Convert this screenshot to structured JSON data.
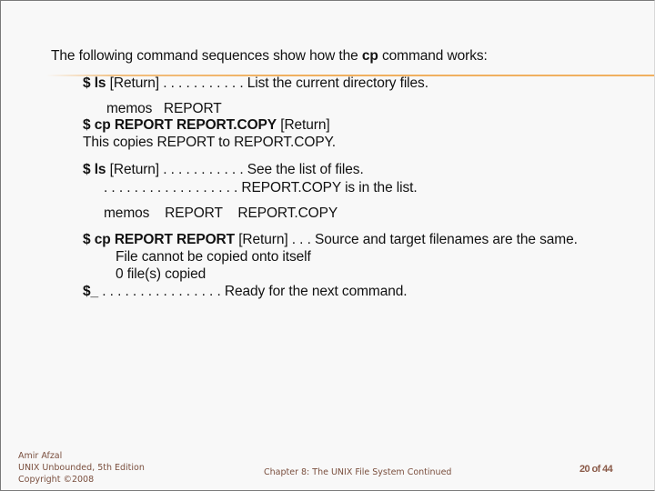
{
  "slide": {
    "intro": {
      "prefix": "The following command sequences show how the ",
      "bold": "cp",
      "suffix": " command works:"
    },
    "lines": {
      "l1": {
        "cmd": "$ ls",
        "rest": " [Return] . . . . . . . . . . . List the current directory files."
      },
      "l2": {
        "text": "memos   REPORT"
      },
      "l3": {
        "cmd": "$ cp REPORT REPORT.COPY",
        "rest": " [Return]"
      },
      "l4": {
        "text": "This copies REPORT to REPORT.COPY."
      },
      "l5": {
        "cmd": "$ ls",
        "rest": " [Return] . . . . . . . . . . . See the list of files."
      },
      "l6": {
        "text": ". . . . . . . . . . . . . . . . . . REPORT.COPY is in the list."
      },
      "l7": {
        "text": "memos    REPORT    REPORT.COPY"
      },
      "l8": {
        "cmd": "$ cp REPORT REPORT",
        "rest": " [Return] . . . Source and target filenames are the same."
      },
      "l9": {
        "text": "File cannot be copied onto itself"
      },
      "l10": {
        "text": "0 file(s) copied"
      },
      "l11": {
        "cmd": "$_",
        "rest": " . . . . . . . . . . . . . . . . Ready for the next command."
      }
    }
  },
  "footer": {
    "author": "Amir Afzal",
    "book": "UNIX Unbounded, 5th Edition",
    "copyright": "Copyright ©2008",
    "chapter": "Chapter 8: The UNIX File System Continued",
    "page": "20 of 44"
  },
  "colors": {
    "accent_rule": "#f0b060",
    "footer_text": "#7a4f3e"
  }
}
